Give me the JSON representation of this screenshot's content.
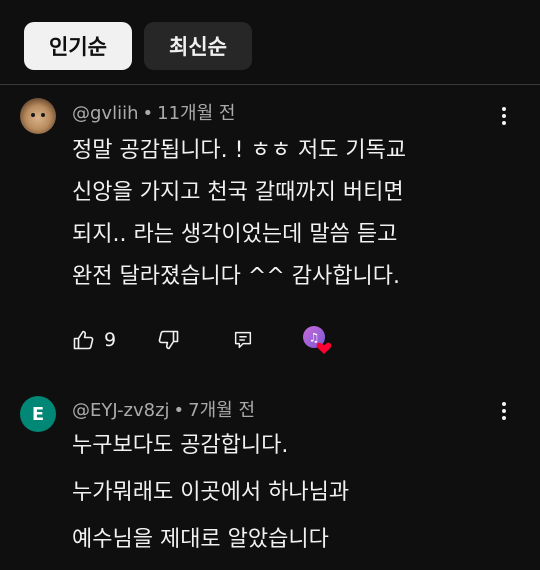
{
  "sort_chips": {
    "popular": "인기순",
    "newest": "최신순"
  },
  "comments": [
    {
      "author": "@gvliih",
      "time": "11개월 전",
      "lines": [
        "정말 공감됩니다. ! ㅎㅎ 저도 기독교",
        "신앙을 가지고 천국 갈때까지 버티면",
        "되지.. 라는 생각이었는데 말씀 듣고",
        "완전 달라졌습니다 ^^ 감사합니다."
      ],
      "likes": "9",
      "avatar_icon": "hamster-avatar",
      "creator_heart": true
    },
    {
      "author": "@EYJ-zv8zj",
      "time": "7개월 전",
      "avatar_letter": "E",
      "avatar_color": "#008775",
      "lines": [
        "누구보다도 공감합니다.",
        "누가뭐래도 이곳에서 하나님과",
        "예수님을 제대로 알았습니다"
      ]
    }
  ],
  "meta_separator": "•",
  "colors": {
    "background": "#0f0f0f",
    "text": "#f1f1f1",
    "secondary_text": "#aaaaaa",
    "heart": "#ff0033"
  }
}
